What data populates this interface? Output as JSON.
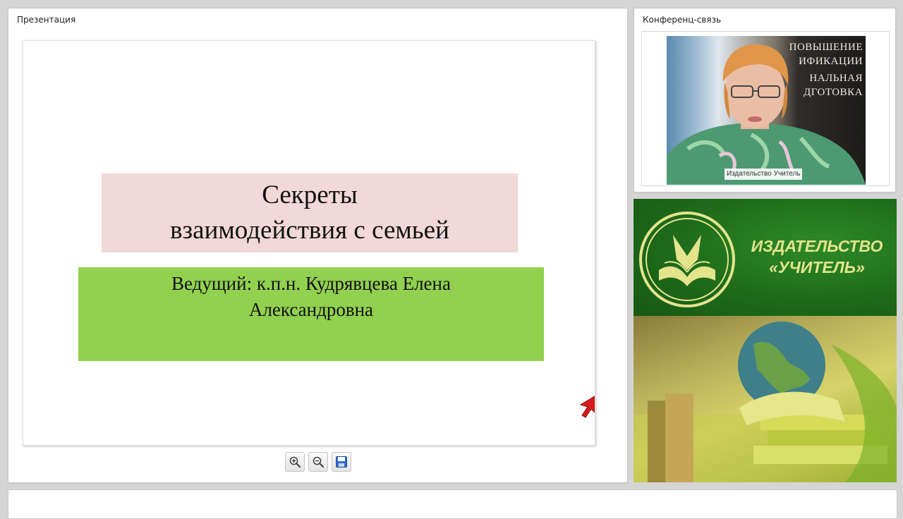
{
  "presentation": {
    "title": "Презентация",
    "slide": {
      "title_line1": "Секреты",
      "title_line2": "взаимодействия с семьей",
      "host_line1": "Ведущий: к.п.н. Кудрявцева Елена",
      "host_line2": "Александровна"
    },
    "toolbar": [
      {
        "icon": "zoom-in-icon"
      },
      {
        "icon": "zoom-out-icon"
      },
      {
        "icon": "save-icon"
      }
    ]
  },
  "conference": {
    "title": "Конференц-связь",
    "video_caption": "Издательство Учитель",
    "banner_lines": [
      "ПОВЫШЕНИЕ",
      "ИФИКАЦИИ",
      "НАЛЬНАЯ",
      "ДГОТОВКА"
    ]
  },
  "publisher": {
    "name_line1": "ИЗДАТЕЛЬСТВО",
    "name_line2": "«УЧИТЕЛЬ»"
  },
  "colors": {
    "title_box": "#f2d8d8",
    "host_box": "#92d050",
    "publisher_green": "#1e6b1a",
    "publisher_text": "#e3e48c"
  }
}
